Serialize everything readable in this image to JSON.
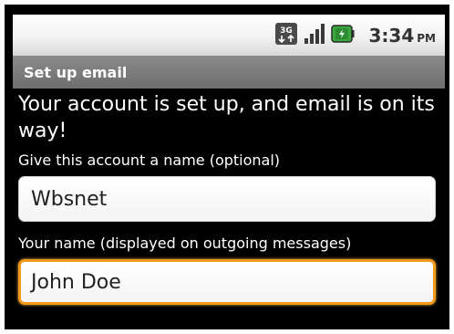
{
  "status_bar": {
    "network_icon": "3g-data-icon",
    "network_text": "3G",
    "signal_icon": "signal-strength-icon",
    "battery_icon": "battery-charging-icon",
    "time": "3:34",
    "ampm": "PM"
  },
  "title_bar": {
    "title": "Set up email"
  },
  "main": {
    "headline": "Your account is set up, and email is on its way!",
    "account_name": {
      "label": "Give this account a name (optional)",
      "value": "Wbsnet"
    },
    "your_name": {
      "label": "Your name (displayed on outgoing messages)",
      "value": "John Doe"
    }
  },
  "colors": {
    "background": "#000000",
    "title_bar": "#7a7a7a",
    "focus_border": "#f49a1c",
    "battery": "#3aa640"
  }
}
